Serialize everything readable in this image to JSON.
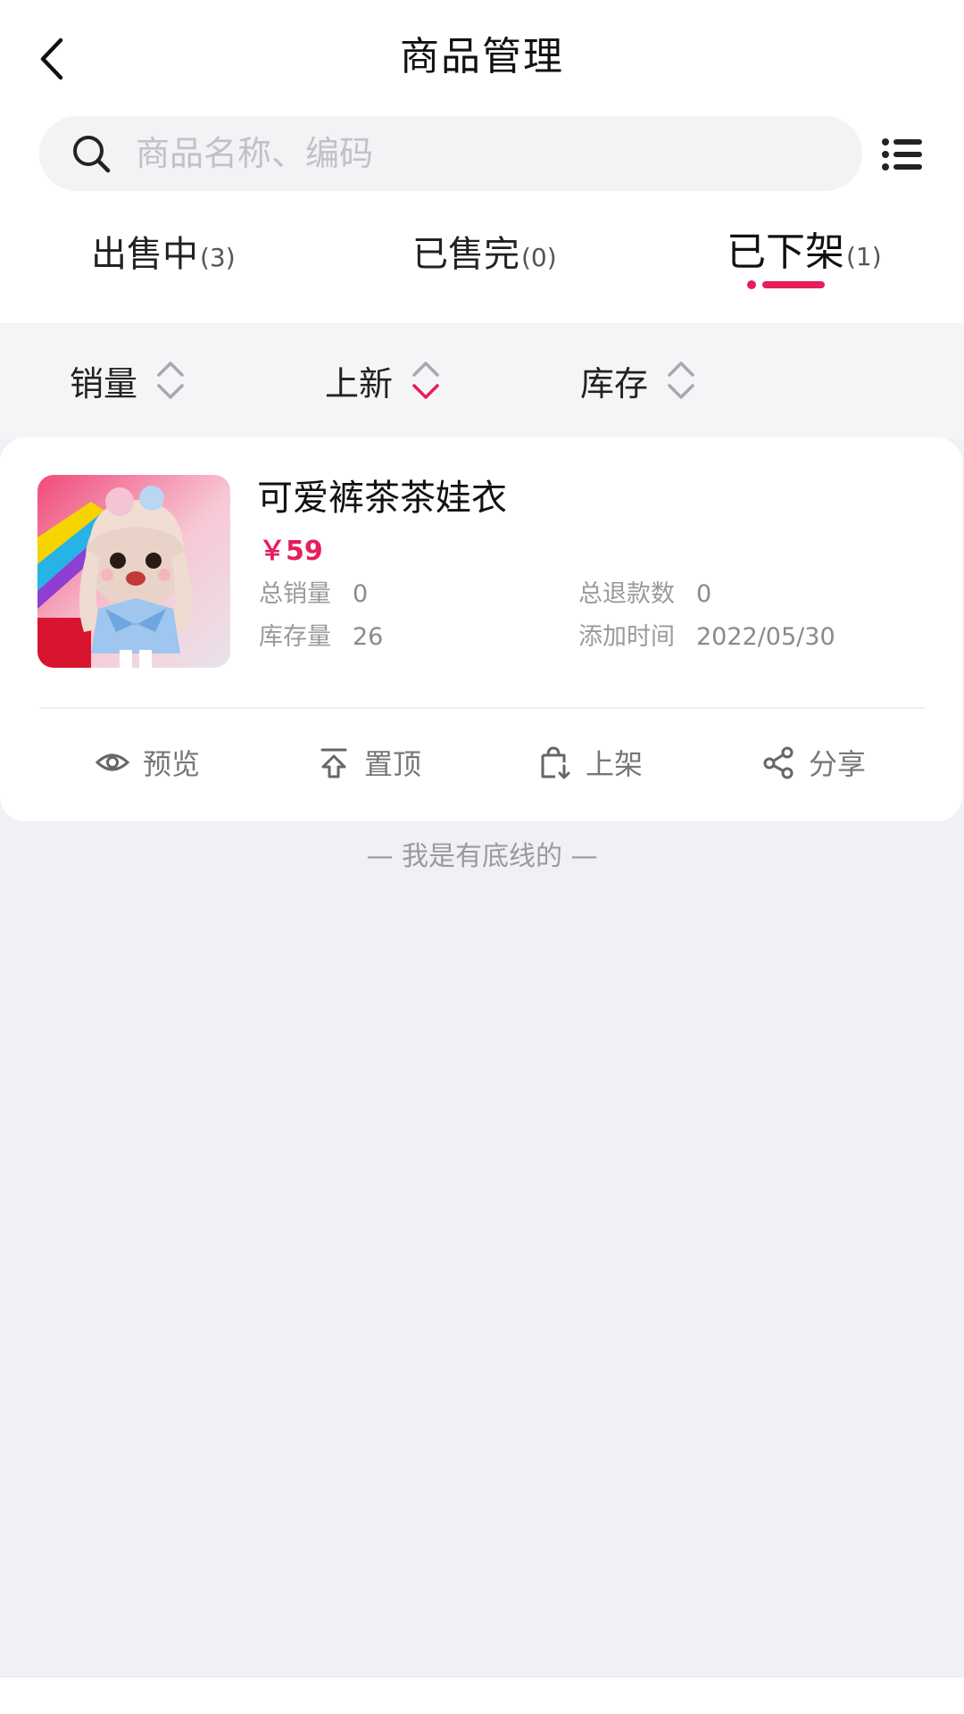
{
  "header": {
    "title": "商品管理"
  },
  "search": {
    "placeholder": "商品名称、编码"
  },
  "tabs": [
    {
      "label": "出售中",
      "count": "(3)",
      "active": false
    },
    {
      "label": "已售完",
      "count": "(0)",
      "active": false
    },
    {
      "label": "已下架",
      "count": "(1)",
      "active": true
    }
  ],
  "sort": [
    {
      "label": "销量",
      "state": "none"
    },
    {
      "label": "上新",
      "state": "desc"
    },
    {
      "label": "库存",
      "state": "none"
    }
  ],
  "product": {
    "name": "可爱裤茶茶娃衣",
    "price": "￥59",
    "total_sales_label": "总销量",
    "total_sales": "0",
    "total_refunds_label": "总退款数",
    "total_refunds": "0",
    "stock_label": "库存量",
    "stock": "26",
    "added_time_label": "添加时间",
    "added_time": "2022/05/30",
    "image_icon": "doll-product-image"
  },
  "actions": [
    {
      "label": "预览",
      "icon": "eye-icon"
    },
    {
      "label": "置顶",
      "icon": "pin-top-icon"
    },
    {
      "label": "上架",
      "icon": "shelf-up-icon"
    },
    {
      "label": "分享",
      "icon": "share-icon"
    }
  ],
  "footer": {
    "text": "— 我是有底线的 —"
  },
  "colors": {
    "accent": "#e61e5a",
    "background": "#f0f1f5",
    "card": "#ffffff"
  }
}
